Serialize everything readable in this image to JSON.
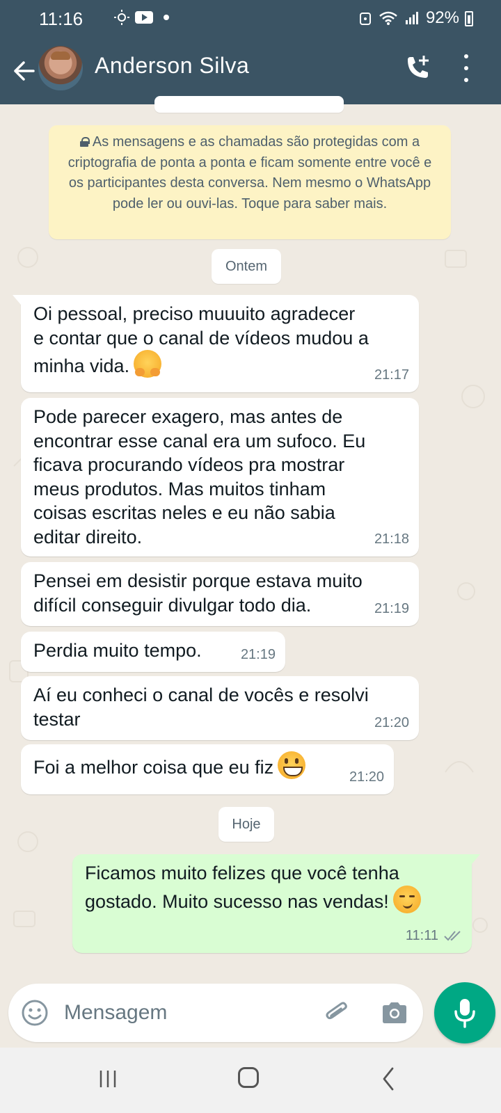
{
  "status_bar": {
    "time": "11:16",
    "battery": "92%"
  },
  "header": {
    "contact_name": "Anderson Silva"
  },
  "encryption_notice": "As mensagens e as chamadas são protegidas com a criptografia de ponta a ponta e ficam somente entre você e os participantes desta conversa. Nem mesmo o WhatsApp pode ler ou ouvi-las. Toque para saber mais.",
  "date_labels": {
    "yesterday": "Ontem",
    "today": "Hoje"
  },
  "messages": [
    {
      "direction": "incoming",
      "text": "Oi pessoal, preciso muuuito agradecer\ne contar que o canal de vídeos mudou a\nminha vida.",
      "emoji": "hugging-face",
      "time": "21:17"
    },
    {
      "direction": "incoming",
      "text": "Pode parecer exagero, mas antes de\nencontrar esse canal era um sufoco. Eu\nficava procurando vídeos pra mostrar\nmeus produtos. Mas muitos tinham\ncoisas escritas neles e eu não sabia\neditar direito.",
      "time": "21:18"
    },
    {
      "direction": "incoming",
      "text": "Pensei em desistir porque estava muito\ndifícil conseguir divulgar todo dia.",
      "time": "21:19"
    },
    {
      "direction": "incoming",
      "text": "Perdia muito tempo.",
      "time": "21:19"
    },
    {
      "direction": "incoming",
      "text": "Aí eu conheci o canal de vocês e resolvi\ntestar",
      "time": "21:20"
    },
    {
      "direction": "incoming",
      "text": "Foi a melhor coisa que eu fiz",
      "emoji": "grinning-face",
      "time": "21:20"
    },
    {
      "direction": "outgoing",
      "text": "Ficamos muito felizes que você tenha\ngostado. Muito sucesso nas vendas!",
      "emoji": "smirking-face",
      "time": "11:11",
      "status": "read"
    }
  ],
  "composer": {
    "placeholder": "Mensagem"
  },
  "colors": {
    "header_bg": "#3b5464",
    "chat_bg": "#efeae2",
    "outgoing_bubble": "#d9fdd3",
    "notice_bg": "#fdf3c5",
    "mic_button": "#00a884",
    "read_ticks": "#8696a0"
  },
  "icons": [
    "back-arrow-icon",
    "add-call-icon",
    "more-vertical-icon",
    "lock-icon",
    "emoji-icon",
    "attach-icon",
    "camera-icon",
    "mic-icon"
  ]
}
